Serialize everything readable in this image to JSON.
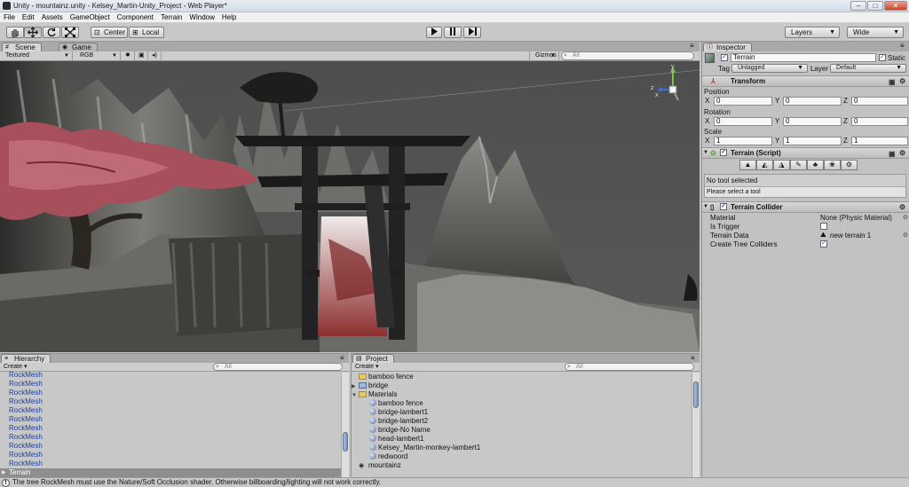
{
  "window": {
    "title": "Unity - mountainz.unity - Kelsey_Martin-Unity_Project - Web Player*"
  },
  "menu": [
    "File",
    "Edit",
    "Assets",
    "GameObject",
    "Component",
    "Terrain",
    "Window",
    "Help"
  ],
  "toolbar": {
    "tool_icons": [
      "hand-icon",
      "move-icon",
      "rotate-icon",
      "scale-icon"
    ],
    "pivot_label": "Center",
    "space_label": "Local",
    "layers_label": "Layers",
    "layout_label": "Wide"
  },
  "scene": {
    "tabs": [
      "Scene",
      "Game"
    ],
    "render_mode": "Textured",
    "color_mode": "RGB",
    "gizmos_label": "Gizmos",
    "search_placeholder": "All",
    "axis_x": "x",
    "axis_y": "y",
    "axis_z": "z"
  },
  "inspector": {
    "tab": "Inspector",
    "object_name": "Terrain",
    "static_label": "Static",
    "tag_label": "Tag",
    "tag_value": "Untagged",
    "layer_label": "Layer",
    "layer_value": "Default",
    "transform": {
      "title": "Transform",
      "position_label": "Position",
      "rotation_label": "Rotation",
      "scale_label": "Scale",
      "axis": [
        "X",
        "Y",
        "Z"
      ],
      "position": [
        "0",
        "0",
        "0"
      ],
      "rotation": [
        "0",
        "0",
        "0"
      ],
      "scale": [
        "1",
        "1",
        "1"
      ]
    },
    "terrain_script": {
      "title": "Terrain (Script)",
      "status": "No tool selected",
      "hint": "Please select a tool"
    },
    "terrain_collider": {
      "title": "Terrain Collider",
      "material_label": "Material",
      "material_value": "None (Physic Material)",
      "is_trigger_label": "Is Trigger",
      "terrain_data_label": "Terrain Data",
      "terrain_data_value": "new terrain 1",
      "tree_colliders_label": "Create Tree Colliders"
    }
  },
  "hierarchy": {
    "tab": "Hierarchy",
    "create_label": "Create",
    "search_placeholder": "All",
    "items": [
      "RockMesh",
      "RockMesh",
      "RockMesh",
      "RockMesh",
      "RockMesh",
      "RockMesh",
      "RockMesh",
      "RockMesh",
      "RockMesh",
      "RockMesh",
      "RockMesh"
    ],
    "selected": "Terrain"
  },
  "project": {
    "tab": "Project",
    "create_label": "Create",
    "search_placeholder": "All",
    "items": [
      {
        "label": "bamboo fence",
        "kind": "folder",
        "indent": 0,
        "arrow": ""
      },
      {
        "label": "bridge",
        "kind": "prefab",
        "indent": 0,
        "arrow": "▶"
      },
      {
        "label": "Materials",
        "kind": "folder",
        "indent": 0,
        "arrow": "▼"
      },
      {
        "label": "bamboo fence",
        "kind": "material",
        "indent": 1,
        "arrow": ""
      },
      {
        "label": "bridge-lambert1",
        "kind": "material",
        "indent": 1,
        "arrow": ""
      },
      {
        "label": "bridge-lambert2",
        "kind": "material",
        "indent": 1,
        "arrow": ""
      },
      {
        "label": "bridge-No Name",
        "kind": "material",
        "indent": 1,
        "arrow": ""
      },
      {
        "label": "head-lambert1",
        "kind": "material",
        "indent": 1,
        "arrow": ""
      },
      {
        "label": "Kelsey_Martin-monkey-lambert1",
        "kind": "material",
        "indent": 1,
        "arrow": ""
      },
      {
        "label": "redwoord",
        "kind": "material",
        "indent": 1,
        "arrow": ""
      },
      {
        "label": "mountainz",
        "kind": "scene",
        "indent": 0,
        "arrow": ""
      }
    ]
  },
  "status": {
    "message": "The tree RockMesh must use the Nature/Soft Occlusion shader. Otherwise billboarding/lighting will not work correctly."
  }
}
